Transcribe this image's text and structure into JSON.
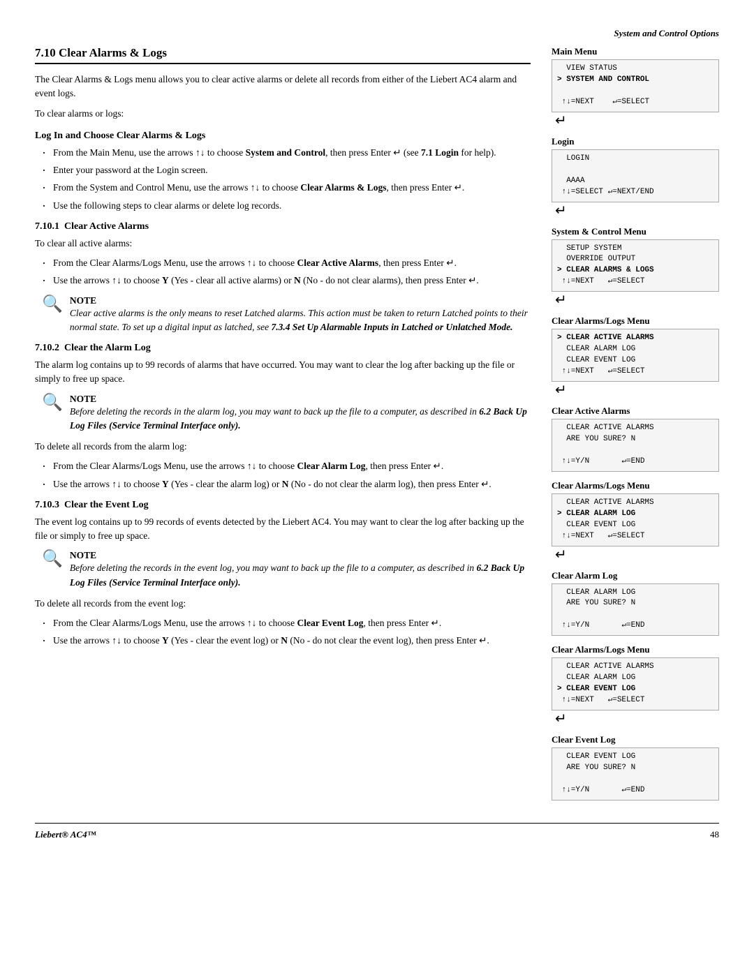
{
  "header": {
    "section_label": "System and Control Options"
  },
  "main_section": {
    "number": "7.10",
    "title": "Clear Alarms & Logs",
    "intro_p1": "The Clear Alarms & Logs menu allows you to clear active alarms or delete all records from either of the Liebert AC4 alarm and event logs.",
    "intro_p2": "To clear alarms or logs:",
    "log_in_heading": "Log In and Choose Clear Alarms & Logs",
    "log_in_bullets": [
      "From the Main Menu, use the arrows ↑↓ to choose System and Control, then press Enter ↵ (see 7.1 Login for help).",
      "Enter your password at the Login screen.",
      "From the System and Control Menu, use the arrows ↑↓ to choose Clear Alarms & Logs, then press Enter ↵.",
      "Use the following steps to clear alarms or delete log records."
    ],
    "subsections": [
      {
        "number": "7.10.1",
        "title": "Clear Active Alarms",
        "intro": "To clear all active alarms:",
        "bullets": [
          "From the Clear Alarms/Logs Menu, use the arrows ↑↓ to choose Clear Active Alarms, then press Enter ↵.",
          "Use the arrows ↑↓ to choose Y (Yes - clear all active alarms) or N (No - do not clear alarms), then press Enter ↵."
        ],
        "note": {
          "label": "NOTE",
          "lines": [
            "Clear active alarms is the only means to reset Latched alarms.",
            "This action must be taken to return Latched points to their normal state. To set up a digital input as latched, see 7.3.4 Set Up Alarmable Inputs in Latched or Unlatched Mode."
          ],
          "bold_part": "Up Alarmable Inputs in Latched or Unlatched Mode."
        }
      },
      {
        "number": "7.10.2",
        "title": "Clear the Alarm Log",
        "intro_p1": "The alarm log contains up to 99 records of alarms that have occurred. You may want to clear the log after backing up the file or simply to free up space.",
        "note": {
          "label": "NOTE",
          "lines": [
            "Before deleting the records in the alarm log, you may want to back up the file to a computer, as described in 6.2 Back Up Log Files (Service Terminal Interface only)."
          ],
          "bold_part": "Log Files (Service Terminal Interface only)."
        },
        "delete_intro": "To delete all records from the alarm log:",
        "bullets": [
          "From the Clear Alarms/Logs Menu, use the arrows ↑↓ to choose Clear Alarm Log, then press Enter ↵.",
          "Use the arrows ↑↓ to choose Y (Yes - clear the alarm log) or N (No - do not clear the alarm log), then press Enter ↵."
        ]
      },
      {
        "number": "7.10.3",
        "title": "Clear the Event Log",
        "intro_p1": "The event log contains up to 99 records of events detected by the Liebert AC4. You may want to clear the log after backing up the file or simply to free up space.",
        "note": {
          "label": "NOTE",
          "lines": [
            "Before deleting the records in the event log, you may want to back up the file to a computer, as described in 6.2 Back Up Log Files (Service Terminal Interface only)."
          ],
          "bold_part": "Log Files (Service Terminal Interface only)."
        },
        "delete_intro": "To delete all records from the event log:",
        "bullets": [
          "From the Clear Alarms/Logs Menu, use the arrows ↑↓ to choose Clear Event Log, then press Enter ↵.",
          "Use the arrows ↑↓ to choose Y (Yes - clear the event log) or N (No - do not clear the event log), then press Enter ↵."
        ]
      }
    ]
  },
  "right_panels": {
    "main_menu": {
      "label": "Main Menu",
      "lines": [
        "  VIEW STATUS",
        "> SYSTEM AND CONTROL",
        "",
        " ↑↓=NEXT    ↵=SELECT"
      ]
    },
    "login": {
      "label": "Login",
      "lines": [
        "  LOGIN",
        "",
        "  AAAA",
        " ↑↓=SELECT ↵=NEXT/END"
      ]
    },
    "system_control_menu": {
      "label": "System & Control Menu",
      "lines": [
        "  SETUP SYSTEM",
        "  OVERRIDE OUTPUT",
        "> CLEAR ALARMS & LOGS",
        " ↑↓=NEXT   ↵=SELECT"
      ]
    },
    "clear_alarms_logs_menu_1": {
      "label": "Clear Alarms/Logs Menu",
      "lines": [
        "> CLEAR ACTIVE ALARMS",
        "  CLEAR ALARM LOG",
        "  CLEAR EVENT LOG",
        " ↑↓=NEXT   ↵=SELECT"
      ]
    },
    "clear_active_alarms_screen": {
      "label": "Clear Active Alarms",
      "lines": [
        "  CLEAR ACTIVE ALARMS",
        "  ARE YOU SURE? N",
        "",
        " ↑↓=Y/N       ↵=END"
      ]
    },
    "clear_alarms_logs_menu_2": {
      "label": "Clear Alarms/Logs Menu",
      "lines": [
        "  CLEAR ACTIVE ALARMS",
        "> CLEAR ALARM LOG",
        "  CLEAR EVENT LOG",
        " ↑↓=NEXT   ↵=SELECT"
      ]
    },
    "clear_alarm_log_screen": {
      "label": "Clear Alarm Log",
      "lines": [
        "  CLEAR ALARM LOG",
        "  ARE YOU SURE? N",
        "",
        " ↑↓=Y/N       ↵=END"
      ]
    },
    "clear_alarms_logs_menu_3": {
      "label": "Clear Alarms/Logs Menu",
      "lines": [
        "  CLEAR ACTIVE ALARMS",
        "  CLEAR ALARM LOG",
        "> CLEAR EVENT LOG",
        " ↑↓=NEXT   ↵=SELECT"
      ]
    },
    "clear_event_log_screen": {
      "label": "Clear Event Log",
      "lines": [
        "  CLEAR EVENT LOG",
        "  ARE YOU SURE? N",
        "",
        " ↑↓=Y/N       ↵=END"
      ]
    }
  },
  "footer": {
    "brand": "Liebert® AC4™",
    "page": "48"
  }
}
